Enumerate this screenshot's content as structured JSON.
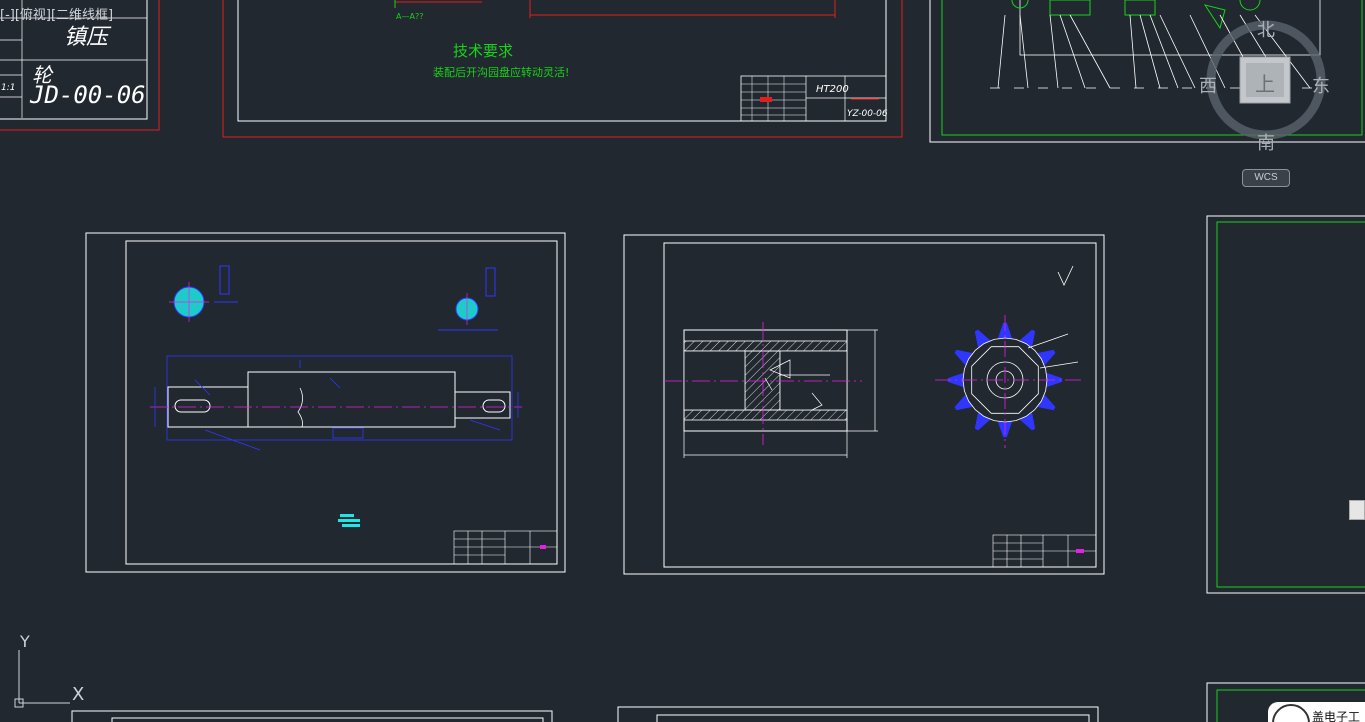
{
  "viewport_label": "[-][俯视][二维线框]",
  "colors": {
    "background": "#212830",
    "sheet_border": "#ffffff",
    "red_border": "#e0201c",
    "green": "#19d219",
    "blue": "#2f37ff",
    "cyan": "#1ee6e6",
    "magenta": "#e81ee8",
    "yellow": "#e6e61e"
  },
  "compass": {
    "north": "北",
    "south": "南",
    "east": "东",
    "west": "西",
    "top": "上",
    "wcs": "WCS"
  },
  "ucs": {
    "x": "X",
    "y": "Y"
  },
  "sheet_left": {
    "title": "镇压轮",
    "title_part1": "镇压",
    "title_part2": "轮",
    "drawing_no": "JD-00-06",
    "scale": "1:1"
  },
  "sheet_top_center": {
    "section_label": "A—A??",
    "tech_req_title": "技术要求",
    "tech_req_text": "装配后开沟园盘应转动灵活!",
    "material": "HT200",
    "drawing_no": "YZ-00-06"
  },
  "user": {
    "name": "盖电子工"
  }
}
